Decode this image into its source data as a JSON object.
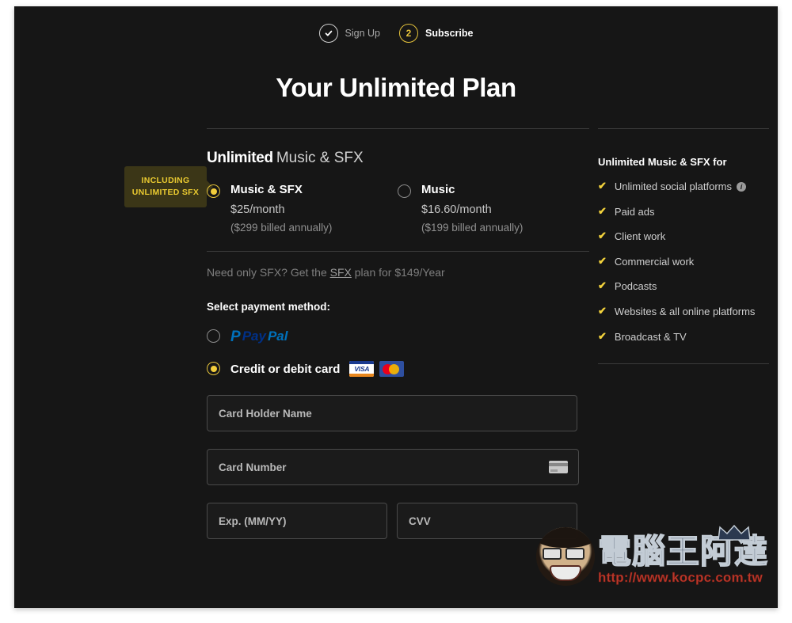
{
  "steps": [
    {
      "label": "Sign Up",
      "state": "completed",
      "icon": "check-icon"
    },
    {
      "label": "Subscribe",
      "state": "current",
      "number": "2"
    }
  ],
  "page_title": "Your Unlimited Plan",
  "plan": {
    "heading_bold": "Unlimited",
    "heading_rest": "Music & SFX",
    "badge_line1": "INCLUDING",
    "badge_line2": "UNLIMITED SFX",
    "options": [
      {
        "name": "Music & SFX",
        "price": "$25/month",
        "note": "($299 billed annually)",
        "selected": true
      },
      {
        "name": "Music",
        "price": "$16.60/month",
        "note": "($199 billed annually)",
        "selected": false
      }
    ],
    "sfx_prefix": "Need only SFX? Get the ",
    "sfx_link": "SFX",
    "sfx_suffix": " plan for $149/Year"
  },
  "payment": {
    "title": "Select payment method:",
    "paypal": {
      "label_mark": "P",
      "label_pay": "Pay",
      "label_pal": "Pal",
      "selected": false
    },
    "card": {
      "label": "Credit or debit card",
      "selected": true,
      "logos": [
        "visa-logo",
        "mastercard-logo"
      ],
      "visa_text": "VISA"
    },
    "fields": {
      "card_holder_placeholder": "Card Holder Name",
      "card_number_placeholder": "Card Number",
      "expiry_placeholder": "Exp. (MM/YY)",
      "cvv_placeholder": "CVV"
    }
  },
  "sidebar": {
    "title": "Unlimited Music & SFX for",
    "features": [
      {
        "label": "Unlimited social platforms",
        "info": true,
        "info_glyph": "i"
      },
      {
        "label": "Paid ads",
        "info": false
      },
      {
        "label": "Client work",
        "info": false
      },
      {
        "label": "Commercial work",
        "info": false
      },
      {
        "label": "Podcasts",
        "info": false
      },
      {
        "label": "Websites & all online platforms",
        "info": false
      },
      {
        "label": "Broadcast & TV",
        "info": false
      }
    ]
  },
  "watermark": {
    "brand": "電腦王阿達",
    "url": "http://www.kocpc.com.tw"
  },
  "colors": {
    "background": "#161616",
    "accent_yellow": "#f2cd3c",
    "badge_bg": "#3b3617",
    "text_primary": "#ffffff",
    "text_muted": "#8f8f8f",
    "paypal_blue": "#0070ba",
    "visa_blue": "#1a3a8f",
    "mc_red": "#eb001b",
    "mc_yellow": "#f7b600"
  }
}
